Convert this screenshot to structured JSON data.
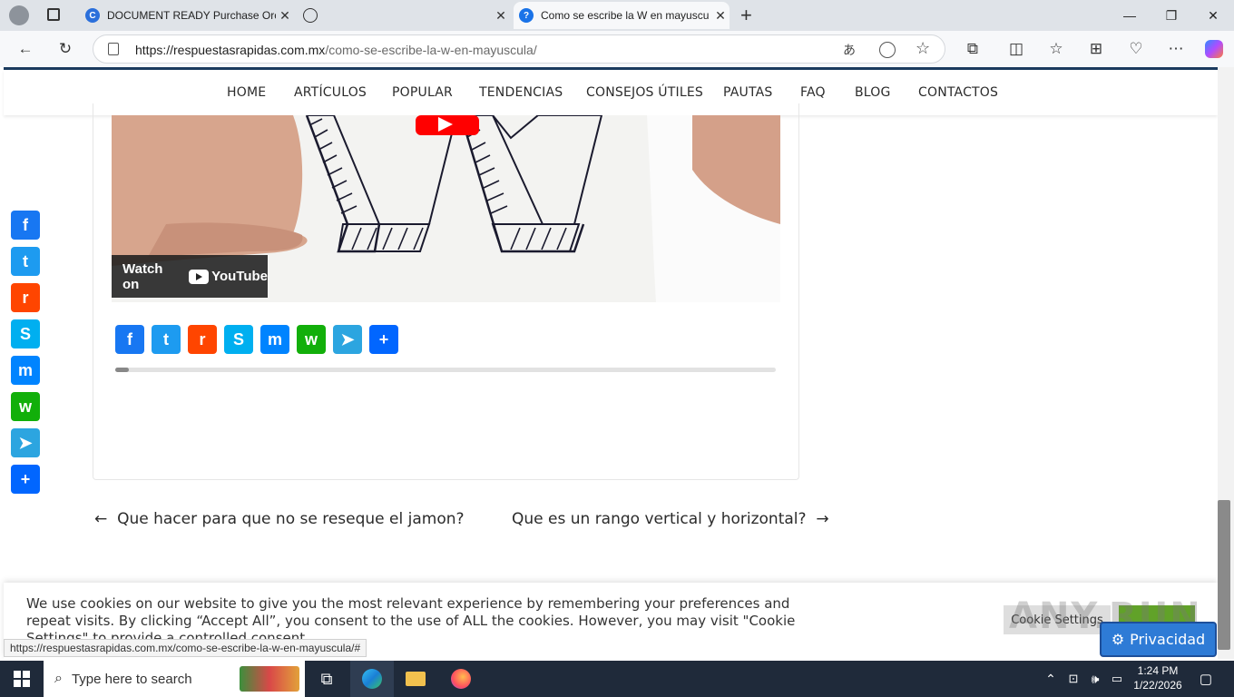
{
  "browser": {
    "tabs": [
      {
        "title": "DOCUMENT READY Purchase Orc",
        "active": false,
        "icon": "edge-c-icon"
      },
      {
        "title": "",
        "active": false,
        "icon": "globe-icon"
      },
      {
        "title": "Como se escribe la W en mayuscu",
        "active": true,
        "icon": "question-icon"
      }
    ],
    "new_tab": "+",
    "url_domain": "https://respuestasrapidas.com.mx",
    "url_path": "/como-se-escribe-la-w-en-mayuscula/"
  },
  "site_nav": {
    "items": [
      "HOME",
      "ARTÍCULOS",
      "POPULAR",
      "TENDENCIAS",
      "CONSEJOS ÚTILES",
      "PAUTAS",
      "FAQ",
      "BLOG",
      "CONTACTOS"
    ]
  },
  "video": {
    "watch_label": "Watch on",
    "platform": "YouTube"
  },
  "share_buttons": [
    {
      "name": "Facebook",
      "color": "#1877f2",
      "glyph": "f"
    },
    {
      "name": "Twitter",
      "color": "#1d9bf0",
      "glyph": "t"
    },
    {
      "name": "Reddit",
      "color": "#ff4500",
      "glyph": "r"
    },
    {
      "name": "Skype",
      "color": "#00aff0",
      "glyph": "S"
    },
    {
      "name": "Messenger",
      "color": "#0084ff",
      "glyph": "m"
    },
    {
      "name": "WhatsApp",
      "color": "#12af0a",
      "glyph": "w"
    },
    {
      "name": "Telegram",
      "color": "#2ca5e0",
      "glyph": "➤"
    },
    {
      "name": "Share",
      "color": "#0166ff",
      "glyph": "+"
    }
  ],
  "reading_progress": 0.02,
  "post_navigation": {
    "prev": "Que hacer para que no se reseque el jamon?",
    "next": "Que es un rango vertical y horizontal?",
    "prev_arrow": "←",
    "next_arrow": "→"
  },
  "cookie_banner": {
    "text": "We use cookies on our website to give you the most relevant experience by remembering your preferences and repeat visits. By clicking “Accept All”, you consent to the use of ALL the cookies. However, you may visit \"Cookie Settings\" to provide a controlled consent.",
    "settings_label": "Cookie Settings",
    "accept_label": "",
    "watermark": "ANY.RUN"
  },
  "privacy_button": "Privacidad",
  "status_url": "https://respuestasrapidas.com.mx/como-se-escribe-la-w-en-mayuscula/#",
  "taskbar": {
    "search_placeholder": "Type here to search",
    "time": "1:24 PM",
    "date": "1/22/2026"
  }
}
